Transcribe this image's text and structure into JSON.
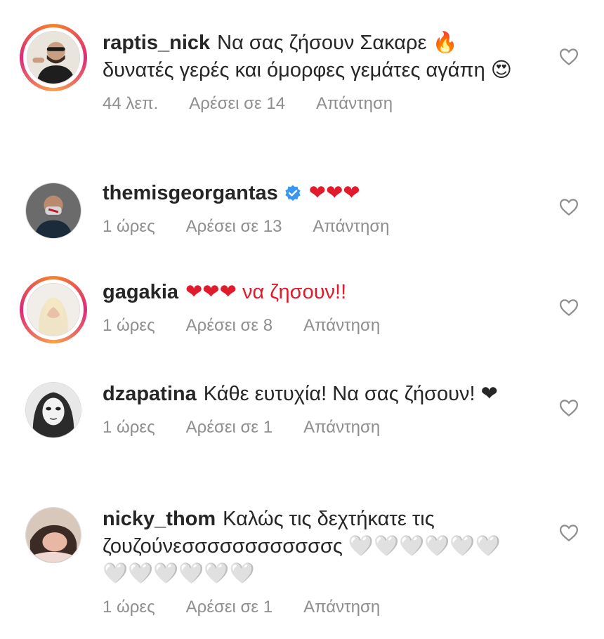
{
  "comments": [
    {
      "username": "raptis_nick",
      "text": "Να σας ζήσουν Σακαρε 🔥 δυνατές γερές και όμορφες γεμάτες αγάπη 😍",
      "time": "44 λεπ.",
      "likes": "Αρέσει σε 14",
      "reply": "Απάντηση",
      "story_ring": true,
      "verified": false
    },
    {
      "username": "themisgeorgantas",
      "text": "❤❤❤",
      "time": "1 ώρες",
      "likes": "Αρέσει σε 13",
      "reply": "Απάντηση",
      "story_ring": false,
      "verified": true
    },
    {
      "username": "gagakia",
      "text": "❤❤❤ να ζησουν!!",
      "time": "1 ώρες",
      "likes": "Αρέσει σε 8",
      "reply": "Απάντηση",
      "story_ring": true,
      "verified": false
    },
    {
      "username": "dzapatina",
      "text": "Κάθε ευτυχία! Να σας ζήσουν! ❤",
      "time": "1 ώρες",
      "likes": "Αρέσει σε 1",
      "reply": "Απάντηση",
      "story_ring": false,
      "verified": false
    },
    {
      "username": "nicky_thom",
      "text": "Καλώς τις δεχτήκατε τις ζουζούνεσσσσσσσσσσσσς 🤍🤍🤍🤍🤍🤍🤍🤍🤍🤍🤍🤍",
      "time": "1 ώρες",
      "likes": "Αρέσει σε 1",
      "reply": "Απάντηση",
      "story_ring": false,
      "verified": false
    }
  ],
  "icons": {
    "like": "heart-outline-icon",
    "verified": "verified-badge-icon"
  },
  "colors": {
    "username": "#262626",
    "meta": "#8e8e8e",
    "verified": "#3897f0",
    "heart": "#e21b2c"
  }
}
